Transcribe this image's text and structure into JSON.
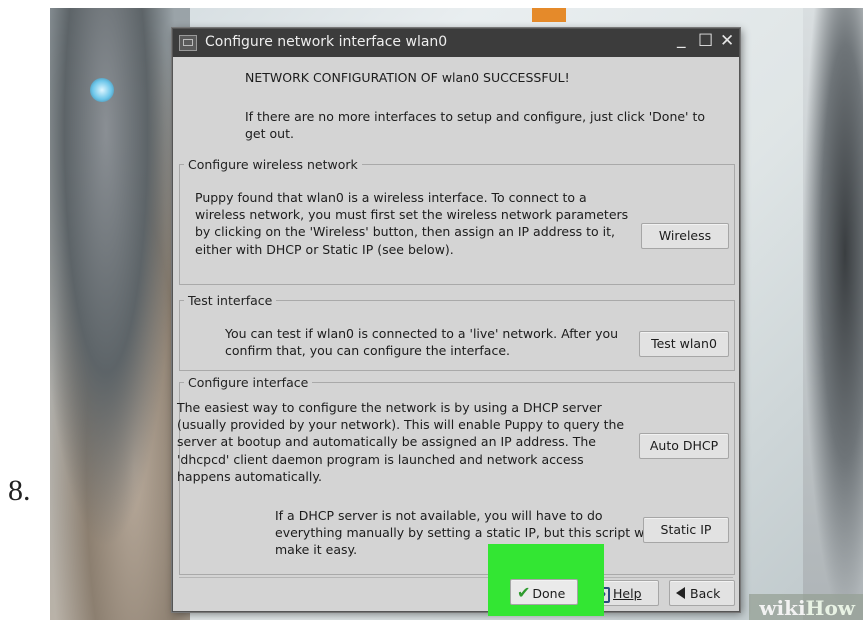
{
  "step": {
    "number": "8."
  },
  "watermark": {
    "wiki": "wiki",
    "how": "How"
  },
  "dialog": {
    "title": "Configure network interface wlan0",
    "window_controls": {
      "minimize": "_",
      "maximize": "☐",
      "close": "✕"
    },
    "success_message": "NETWORK CONFIGURATION OF wlan0 SUCCESSFUL!",
    "hint_message": "If there are no more interfaces to setup and configure, just click 'Done' to get out.",
    "wireless_group": {
      "legend": "Configure wireless network",
      "text": "Puppy found that wlan0 is a wireless interface. To connect to a wireless network, you must first set the wireless network parameters by clicking on the 'Wireless' button, then assign an IP address to it, either with DHCP or Static IP (see below).",
      "button": "Wireless"
    },
    "test_group": {
      "legend": "Test interface",
      "text": "You can test if wlan0 is connected to a 'live' network. After you confirm that, you can configure the interface.",
      "button": "Test wlan0"
    },
    "interface_group": {
      "legend": "Configure interface",
      "dhcp_text": "The easiest way to configure the network is by using a DHCP server (usually provided by your network). This will enable Puppy to query the server at bootup and automatically be assigned an IP address. The 'dhcpcd' client daemon program is launched and network access happens automatically.",
      "dhcp_button": "Auto DHCP",
      "static_text": "If a DHCP server is not available, you will have to do everything manually by setting a static IP, but this script will make it easy.",
      "static_button": "Static IP"
    },
    "footer": {
      "done_label": "Done",
      "help_label": "Help",
      "back_label": "Back"
    }
  },
  "colors": {
    "highlight": "#33e633",
    "titlebar": "#3c3c3c",
    "dialog_bg": "#d4d4d4"
  }
}
